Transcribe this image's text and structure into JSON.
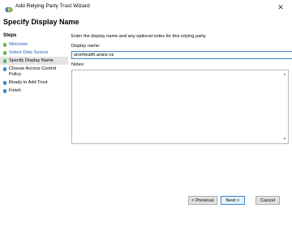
{
  "window": {
    "title": "Add Relying Party Trust Wizard",
    "close_glyph": "✕"
  },
  "page": {
    "heading": "Specify Display Name"
  },
  "sidebar": {
    "heading": "Steps",
    "items": [
      {
        "label": "Welcome",
        "state": "done"
      },
      {
        "label": "Select Data Source",
        "state": "done"
      },
      {
        "label": "Specify Display Name",
        "state": "current"
      },
      {
        "label": "Choose Access Control Policy",
        "state": "pending"
      },
      {
        "label": "Ready to Add Trust",
        "state": "pending"
      },
      {
        "label": "Finish",
        "state": "pending"
      }
    ]
  },
  "main": {
    "instruction": "Enter the display name and any optional notes for this relying party.",
    "display_name_label": "Display name:",
    "display_name_value": "aronhealth.aranz.nz",
    "notes_label": "Notes:",
    "notes_value": ""
  },
  "buttons": {
    "previous": "< Previous",
    "next": "Next >",
    "cancel": "Cancel"
  },
  "colors": {
    "step_done": "#5cb85c",
    "step_pending": "#3f86c8",
    "link": "#1a5fb4",
    "focus_border": "#3f86c8"
  },
  "icons": {
    "app": "relying-party-icon",
    "scroll_up": "scroll-up-icon",
    "scroll_down": "scroll-down-icon"
  }
}
